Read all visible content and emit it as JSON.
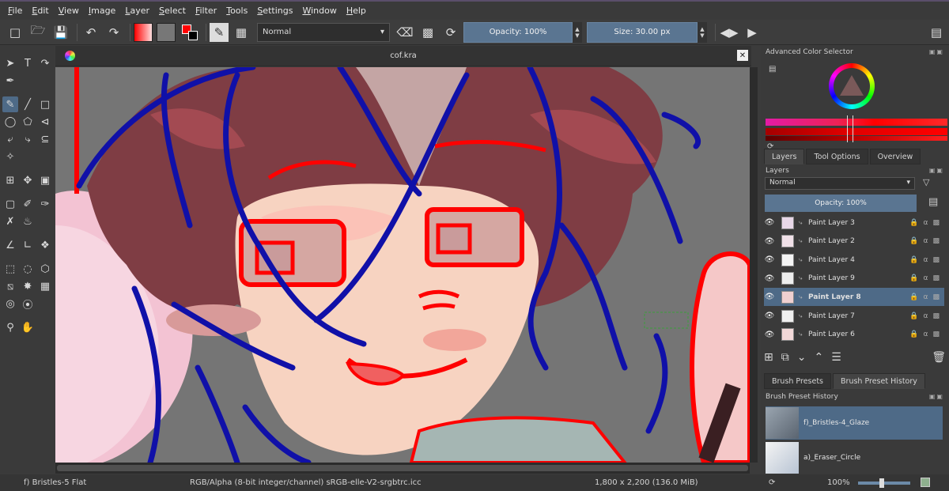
{
  "menu": {
    "items": [
      {
        "label": "File",
        "u": "F",
        "rest": "ile"
      },
      {
        "label": "Edit",
        "u": "E",
        "rest": "dit"
      },
      {
        "label": "View",
        "u": "V",
        "rest": "iew"
      },
      {
        "label": "Image",
        "u": "I",
        "rest": "mage"
      },
      {
        "label": "Layer",
        "u": "L",
        "rest": "ayer"
      },
      {
        "label": "Select",
        "u": "S",
        "rest": "elect"
      },
      {
        "label": "Filter",
        "u": "F",
        "rest": "ilter"
      },
      {
        "label": "Tools",
        "u": "T",
        "rest": "ools"
      },
      {
        "label": "Settings",
        "u": "S",
        "rest": "ettings"
      },
      {
        "label": "Window",
        "u": "W",
        "rest": "indow"
      },
      {
        "label": "Help",
        "u": "H",
        "rest": "elp"
      }
    ]
  },
  "toolbar": {
    "blend_mode": "Normal",
    "opacity_label": "Opacity: 100%",
    "opacity_value": 1.0,
    "size_label": "Size: 30.00 px",
    "foreground_color": "#ff0000",
    "background_color": "#000000"
  },
  "document": {
    "title": "cof.kra"
  },
  "color_selector": {
    "title": "Advanced Color Selector"
  },
  "dock_tabs": {
    "layers": "Layers",
    "tool_options": "Tool Options",
    "overview": "Overview"
  },
  "layers": {
    "title": "Layers",
    "blend_mode": "Normal",
    "opacity_label": "Opacity:  100%",
    "items": [
      {
        "name": "Paint Layer 3",
        "active": false
      },
      {
        "name": "Paint Layer 2",
        "active": false
      },
      {
        "name": "Paint Layer 4",
        "active": false
      },
      {
        "name": "Paint Layer 9",
        "active": false
      },
      {
        "name": "Paint Layer 8",
        "active": true
      },
      {
        "name": "Paint Layer 7",
        "active": false
      },
      {
        "name": "Paint Layer 6",
        "active": false
      }
    ]
  },
  "brush_tabs": {
    "presets": "Brush Presets",
    "history": "Brush Preset History"
  },
  "brush_history": {
    "title": "Brush Preset History",
    "items": [
      {
        "name": "f)_Bristles-4_Glaze",
        "active": true
      },
      {
        "name": "a)_Eraser_Circle",
        "active": false
      }
    ]
  },
  "status": {
    "brush": "f) Bristles-5 Flat",
    "color_model": "RGB/Alpha (8-bit integer/channel)  sRGB-elle-V2-srgbtrc.icc",
    "dimensions": "1,800 x 2,200 (136.0 MiB)",
    "zoom": "100%"
  },
  "accent_colors": {
    "selection": "#4e6a87",
    "slider": "#5a7591"
  }
}
